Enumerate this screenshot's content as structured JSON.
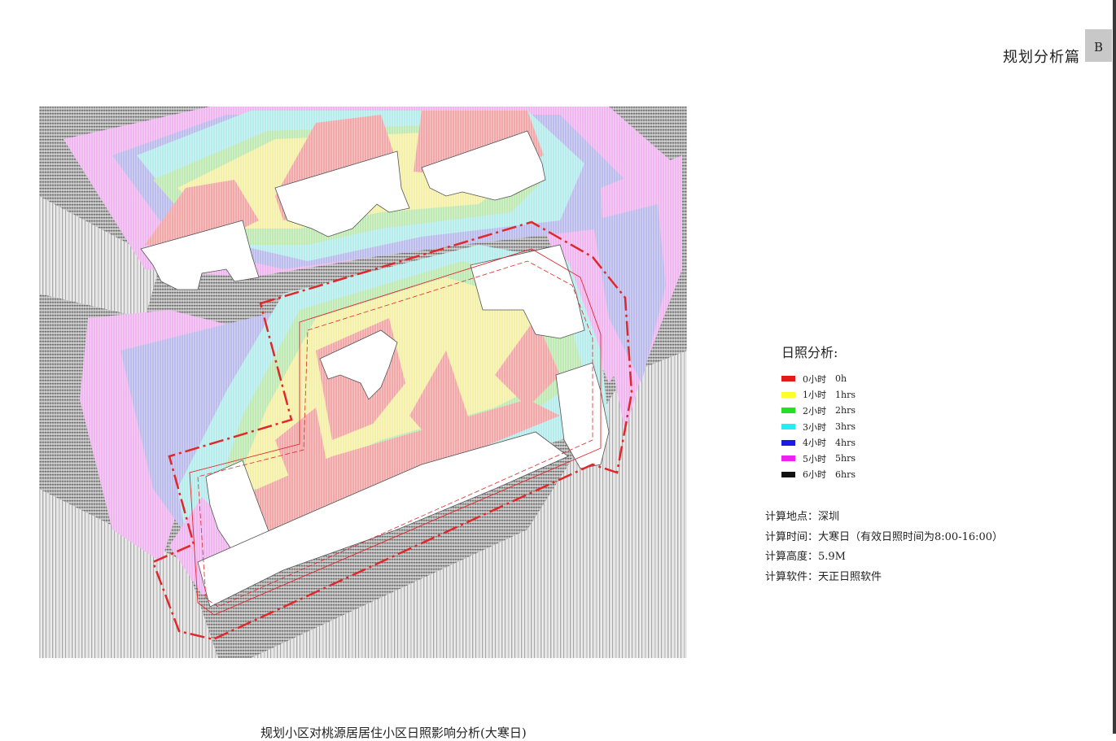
{
  "header": {
    "title": "规划分析篇",
    "tab": "B"
  },
  "legend": {
    "title": "日照分析:",
    "items": [
      {
        "cn": "0小时",
        "en": "0h",
        "color": "#e51b1b"
      },
      {
        "cn": "1小时",
        "en": "1hrs",
        "color": "#ffff2a"
      },
      {
        "cn": "2小时",
        "en": "2hrs",
        "color": "#22e022"
      },
      {
        "cn": "3小时",
        "en": "3hrs",
        "color": "#22f0f0"
      },
      {
        "cn": "4小时",
        "en": "4hrs",
        "color": "#1a1ae6"
      },
      {
        "cn": "5小时",
        "en": "5hrs",
        "color": "#ee22ee"
      },
      {
        "cn": "6小时",
        "en": "6hrs",
        "color": "#111111"
      }
    ]
  },
  "info": [
    "计算地点：深圳",
    "计算时间：大寒日（有效日照时间为8:00-16:00）",
    "计算高度：5.9M",
    "计算软件：天正日照软件"
  ],
  "caption": "规划小区对桃源居居住小区日照影响分析(大寒日)",
  "colors": {
    "boundary": "#e0282a",
    "pale_red": "#f2a8a8",
    "pale_yellow": "#f4f0a8",
    "pale_green": "#bfe9b2",
    "pale_cyan": "#b6ecec",
    "pale_blue": "#bcbcec",
    "pale_magenta": "#f0b6f0",
    "gray_dark": "#8f8f8f",
    "gray_light": "#cdcdcd"
  }
}
